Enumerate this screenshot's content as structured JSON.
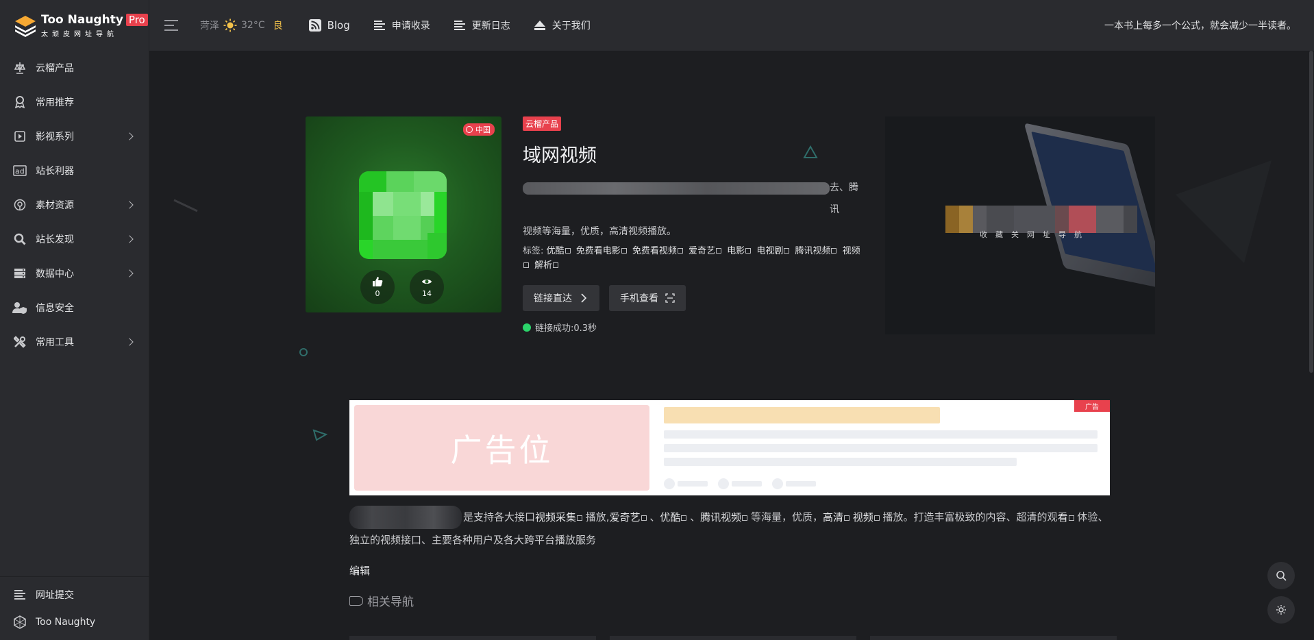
{
  "brand": {
    "name": "Too Naughty",
    "badge": "Pro",
    "subtitle": "太顽皮网址导航"
  },
  "sidebar": {
    "items": [
      {
        "label": "云榴产品",
        "icon": "scale-icon",
        "has_children": false
      },
      {
        "label": "常用推荐",
        "icon": "award-icon",
        "has_children": false
      },
      {
        "label": "影视系列",
        "icon": "video-icon",
        "has_children": true
      },
      {
        "label": "站长利器",
        "icon": "ad-icon",
        "has_children": false
      },
      {
        "label": "素材资源",
        "icon": "resource-icon",
        "has_children": true
      },
      {
        "label": "站长发现",
        "icon": "search-icon",
        "has_children": true
      },
      {
        "label": "数据中心",
        "icon": "server-icon",
        "has_children": true
      },
      {
        "label": "信息安全",
        "icon": "user-shield-icon",
        "has_children": false
      },
      {
        "label": "常用工具",
        "icon": "tools-icon",
        "has_children": true
      }
    ],
    "bottom": [
      {
        "label": "网址提交",
        "icon": "list-icon"
      },
      {
        "label": "Too Naughty",
        "icon": "hexagon-icon"
      }
    ]
  },
  "header": {
    "weather": {
      "city": "菏泽",
      "temp": "32°C",
      "aqi": "良"
    },
    "links": [
      {
        "label": "Blog",
        "icon": "rss-icon"
      },
      {
        "label": "申请收录",
        "icon": "list-icon"
      },
      {
        "label": "更新日志",
        "icon": "list-icon"
      },
      {
        "label": "关于我们",
        "icon": "eject-icon"
      }
    ],
    "quote": "一本书上每多一个公式，就会减少一半读者。"
  },
  "site": {
    "region": "中国",
    "category": "云榴产品",
    "title": "域网视频",
    "description_tail": "去、腾讯",
    "description_line2": "视频等海量，优质，高清视频播放。",
    "tags_label": "标签:",
    "tags": [
      "优酷",
      "免费看电影",
      "免费看视频",
      "爱奇艺",
      "电影",
      "电视剧",
      "腾讯视频",
      "视频",
      "解析"
    ],
    "likes": "0",
    "views": "14",
    "btn_visit": "链接直达",
    "btn_mobile": "手机查看",
    "status": "链接成功:0.3秒",
    "preview_text": "收藏关网址导航"
  },
  "ad": {
    "placeholder": "广告位",
    "label": "广告"
  },
  "content": {
    "intro_a": "是支持各大接口",
    "link_caiji": "视频采集",
    "mid_1": " 播放,",
    "link_aqy": "爱奇艺",
    "mid_2": " 、",
    "link_youku": "优酷",
    "mid_3": " 、",
    "link_tx": "腾讯视频",
    "mid_4": " 等海量，优质，",
    "link_hd": "高清",
    "mid_5": " ",
    "link_video": "视频",
    "mid_6": " 播放。打造丰富极致的内容、超清的观",
    "link_watch": "看",
    "mid_7": " 体验、独立的视频接口、主要各种用户及各大跨平台播放服务",
    "edit": "编辑",
    "related": "相关导航"
  },
  "colors": {
    "accent": "#e8414d",
    "sidebar_bg": "#2a2b2f",
    "page_bg": "#1d1e21",
    "success": "#2bd46a",
    "aqi": "#f3c24a"
  }
}
